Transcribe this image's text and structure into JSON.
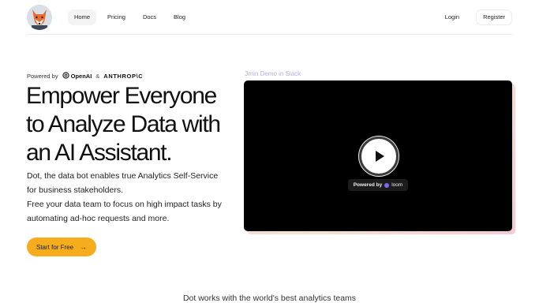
{
  "nav": {
    "links": [
      "Home",
      "Pricing",
      "Docs",
      "Blog"
    ],
    "login": "Login",
    "register": "Register"
  },
  "hero": {
    "powered_prefix": "Powered by",
    "openai": "OpenAI",
    "amp": "&",
    "anthropic": "ANTHROP\\C",
    "headline_lines": [
      "Empower Everyone",
      "to Analyze Data with",
      "an AI Assistant."
    ],
    "desc_lines": [
      "Dot, the data bot enables true Analytics Self-Service",
      "for business stakeholders.",
      "Free your data team to focus on high impact tasks by",
      "automating ad-hoc requests and more."
    ],
    "cta": "Start for Free",
    "cta_arrow": "→"
  },
  "demo": {
    "label": "3min Demo in Slack",
    "powered_by": "Powered by",
    "loom": "loom"
  },
  "footer": {
    "tagline": "Dot works with the world's best analytics teams"
  },
  "colors": {
    "accent": "#f6ad1d",
    "demo_label": "#b6b0dd",
    "video_bg": "#000000"
  },
  "icons": {
    "logo": "fox-logo-icon",
    "openai": "openai-icon",
    "play": "play-icon",
    "loom": "loom-icon",
    "arrow": "arrow-right-icon"
  }
}
